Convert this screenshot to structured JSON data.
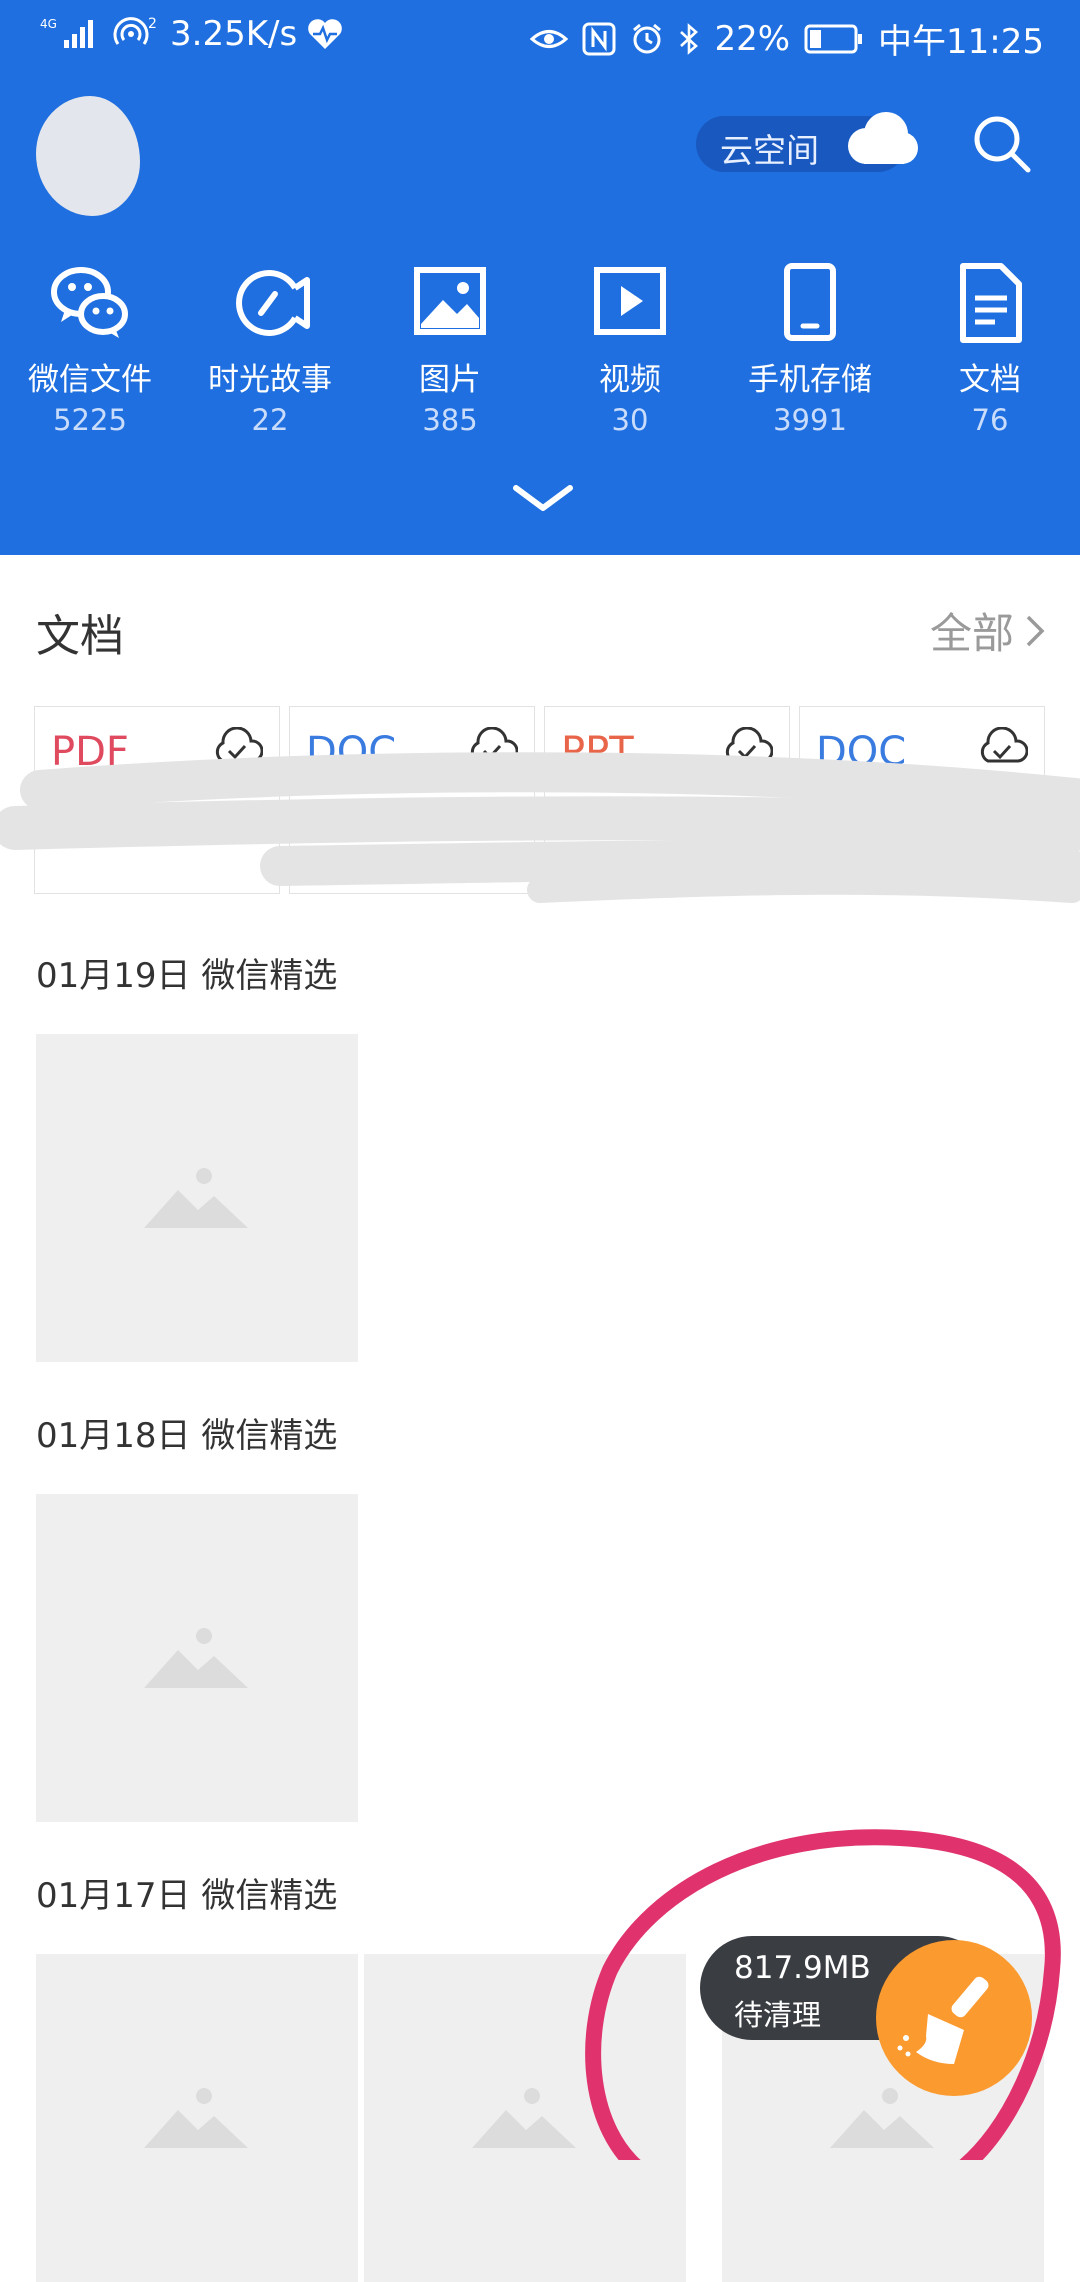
{
  "status_bar": {
    "network_type": "4G",
    "hotspot_count": "2",
    "speed": "3.25K/s",
    "battery": "22%",
    "time": "中午11:25"
  },
  "header": {
    "cloud_space_label": "云空间"
  },
  "categories": [
    {
      "label": "微信文件",
      "count": "5225",
      "icon": "wechat-icon"
    },
    {
      "label": "时光故事",
      "count": "22",
      "icon": "story-icon"
    },
    {
      "label": "图片",
      "count": "385",
      "icon": "image-icon"
    },
    {
      "label": "视频",
      "count": "30",
      "icon": "video-icon"
    },
    {
      "label": "手机存储",
      "count": "3991",
      "icon": "phone-icon"
    },
    {
      "label": "文档",
      "count": "76",
      "icon": "document-icon"
    }
  ],
  "documents": {
    "title": "文档",
    "view_all": "全部",
    "cards": [
      {
        "type": "PDF",
        "color": "#e04a5f"
      },
      {
        "type": "DOC",
        "color": "#3a7be0"
      },
      {
        "type": "PPT",
        "color": "#e8654a"
      },
      {
        "type": "DOC",
        "color": "#3a7be0"
      }
    ]
  },
  "groups": [
    {
      "date": "01月19日 微信精选"
    },
    {
      "date": "01月18日 微信精选"
    },
    {
      "date": "01月17日 微信精选"
    }
  ],
  "cleaner": {
    "size": "817.9MB",
    "label": "待清理"
  },
  "colors": {
    "header_bg": "#1f6fe0",
    "fab_orange": "#fb9a2e",
    "annotation": "#e0336e"
  }
}
